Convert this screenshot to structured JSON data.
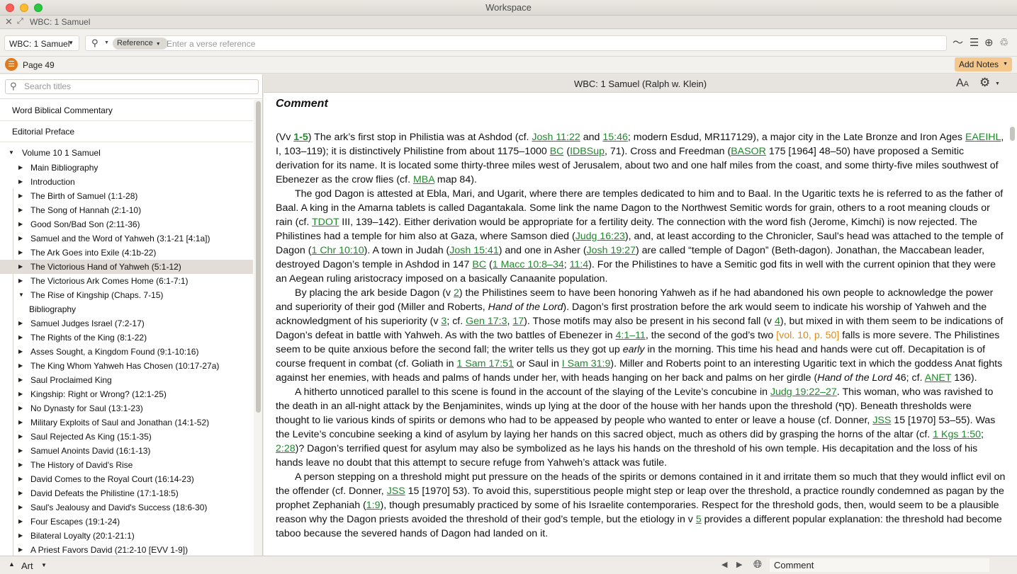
{
  "window": {
    "title": "Workspace"
  },
  "tab": {
    "label": "WBC: 1 Samuel"
  },
  "toolbar": {
    "resource": "WBC: 1 Samuel",
    "search_mode": "Reference",
    "search_placeholder": "Enter a verse reference"
  },
  "pagebar": {
    "page": "Page 49",
    "add_notes": "Add Notes"
  },
  "sidebar": {
    "search_placeholder": "Search titles",
    "top_items": [
      "Word Biblical Commentary",
      "Editorial Preface"
    ],
    "volume": "Volume 10 1 Samuel",
    "items": [
      {
        "label": "Main Bibliography",
        "arrow": "▶"
      },
      {
        "label": "Introduction",
        "arrow": "▶"
      },
      {
        "label": "The Birth of Samuel (1:1-28)",
        "arrow": "▶"
      },
      {
        "label": "The Song of Hannah (2:1-10)",
        "arrow": "▶"
      },
      {
        "label": "Good Son/Bad Son (2:11-36)",
        "arrow": "▶"
      },
      {
        "label": "Samuel and the Word of Yahweh (3:1-21 [4:1a])",
        "arrow": "▶"
      },
      {
        "label": "The Ark Goes into Exile (4:1b-22)",
        "arrow": "▶"
      },
      {
        "label": "The Victorious Hand of Yahweh (5:1-12)",
        "arrow": "▶",
        "selected": true
      },
      {
        "label": "The Victorious Ark Comes Home (6:1-7:1)",
        "arrow": "▶"
      },
      {
        "label": "The Rise of Kingship (Chaps. 7-15)",
        "arrow": "▼"
      },
      {
        "label": "Bibliography",
        "arrow": "",
        "sub": true
      },
      {
        "label": "Samuel Judges Israel (7:2-17)",
        "arrow": "▶"
      },
      {
        "label": "The Rights of the King (8:1-22)",
        "arrow": "▶"
      },
      {
        "label": "Asses Sought, a Kingdom Found (9:1-10:16)",
        "arrow": "▶"
      },
      {
        "label": "The King Whom Yahweh Has Chosen (10:17-27a)",
        "arrow": "▶"
      },
      {
        "label": "Saul Proclaimed King",
        "arrow": "▶"
      },
      {
        "label": "Kingship: Right or Wrong?  (12:1-25)",
        "arrow": "▶"
      },
      {
        "label": "No Dynasty for Saul (13:1-23)",
        "arrow": "▶"
      },
      {
        "label": "Military Exploits of Saul and Jonathan (14:1-52)",
        "arrow": "▶"
      },
      {
        "label": "Saul Rejected As King (15:1-35)",
        "arrow": "▶"
      },
      {
        "label": "Samuel Anoints David (16:1-13)",
        "arrow": "▶"
      },
      {
        "label": "The History of David's Rise",
        "arrow": "▶"
      },
      {
        "label": "David Comes to the Royal Court (16:14-23)",
        "arrow": "▶"
      },
      {
        "label": "David Defeats the Philistine (17:1-18:5)",
        "arrow": "▶"
      },
      {
        "label": "Saul's Jealousy and David's Success (18:6-30)",
        "arrow": "▶"
      },
      {
        "label": "Four Escapes (19:1-24)",
        "arrow": "▶"
      },
      {
        "label": "Bilateral Loyalty (20:1-21:1)",
        "arrow": "▶"
      },
      {
        "label": "A Priest Favors David (21:2-10 [EVV 1-9])",
        "arrow": "▶"
      }
    ]
  },
  "reader": {
    "title": "WBC: 1 Samuel (Ralph w. Klein)",
    "font_button": "AA",
    "section_title": "Comment"
  },
  "content": {
    "paragraphs": [
      [
        {
          "t": "(Vv "
        },
        {
          "t": "1-5",
          "l": true,
          "b": true
        },
        {
          "t": ") The ark’s first stop in Philistia was at Ashdod (cf. "
        },
        {
          "t": "Josh 11:22",
          "l": true
        },
        {
          "t": " and "
        },
        {
          "t": "15:46",
          "l": true
        },
        {
          "t": "; modern Esdud, MR117129), a major city in the Late Bronze and Iron Ages "
        },
        {
          "t": "EAEIHL",
          "l": true
        },
        {
          "t": ", I, 103–119); it is distinctively Philistine from about 1175–1000 "
        },
        {
          "t": "BC",
          "l": true
        },
        {
          "t": " ("
        },
        {
          "t": "IDBSup",
          "l": true
        },
        {
          "t": ", 71). Cross and Freedman ("
        },
        {
          "t": "BASOR",
          "l": true
        },
        {
          "t": " 175 [1964] 48–50) have proposed a Semitic derivation for its name. It is located some thirty-three miles west of Jerusalem, about two and one half miles from the coast, and some thirty-five miles southwest of Ebenezer as the crow flies (cf. "
        },
        {
          "t": "MBA",
          "l": true
        },
        {
          "t": " map 84)."
        }
      ],
      [
        {
          "t": "The god Dagon is attested at Ebla, Mari, and Ugarit, where there are temples dedicated to him and to Baal. In the Ugaritic texts he is referred to as the father of Baal. A king in the Amarna tablets is called Dagantakala. Some link the name Dagon to the Northwest Semitic words for grain, others to a root meaning clouds or rain (cf. "
        },
        {
          "t": "TDOT",
          "l": true
        },
        {
          "t": " III, 139–142). Either derivation would be appropriate for a fertility deity. The connection with the word fish (Jerome, Kimchi) is now rejected. The Philistines had a temple for him also at Gaza, where Samson died ("
        },
        {
          "t": "Judg 16:23",
          "l": true
        },
        {
          "t": "), and, at least according to the Chronicler, Saul’s head was attached to the temple of Dagon ("
        },
        {
          "t": "1 Chr 10:10",
          "l": true
        },
        {
          "t": "). A town in Judah ("
        },
        {
          "t": "Josh 15:41",
          "l": true
        },
        {
          "t": ") and one in Asher ("
        },
        {
          "t": "Josh 19:27",
          "l": true
        },
        {
          "t": ") are called “temple of Dagon” (Beth-dagon). Jonathan, the Maccabean leader, destroyed Dagon’s temple in Ashdod in 147 "
        },
        {
          "t": "BC",
          "l": true
        },
        {
          "t": " ("
        },
        {
          "t": "1 Macc 10:8–34",
          "l": true
        },
        {
          "t": "; "
        },
        {
          "t": "11:4",
          "l": true
        },
        {
          "t": "). For the Philistines to have a Semitic god fits in well with the current opinion that they were an Aegean ruling aristocracy imposed on a basically Canaanite population."
        }
      ],
      [
        {
          "t": "By placing the ark beside Dagon (v "
        },
        {
          "t": "2",
          "l": true
        },
        {
          "t": ") the Philistines seem to have been honoring Yahweh as if he had abandoned his own people to acknowledge the power and superiority of their god (Miller and Roberts, "
        },
        {
          "t": "Hand of the Lord",
          "i": true
        },
        {
          "t": "). Dagon’s first prostration before the ark would seem to indicate his worship of Yahweh and the acknowledgment of his superiority (v "
        },
        {
          "t": "3",
          "l": true
        },
        {
          "t": "; cf. "
        },
        {
          "t": "Gen 17:3",
          "l": true
        },
        {
          "t": ", "
        },
        {
          "t": "17",
          "l": true
        },
        {
          "t": "). Those motifs may also be present in his second fall (v "
        },
        {
          "t": "4",
          "l": true
        },
        {
          "t": "), but mixed in with them seem to be indications of Dagon’s defeat in battle with Yahweh. As with the two battles of Ebenezer in "
        },
        {
          "t": "4:1–11",
          "l": true
        },
        {
          "t": ", the second of the god’s two "
        },
        {
          "t": "[vol. 10, p. 50]",
          "o": true
        },
        {
          "t": " falls is more severe. The Philistines seem to be quite anxious before the second fall; the writer tells us they got up "
        },
        {
          "t": "early",
          "i": true
        },
        {
          "t": " in the morning. This time his head and hands were cut off. Decapitation is of course frequent in combat (cf. Goliath in "
        },
        {
          "t": "1 Sam 17:51",
          "l": true
        },
        {
          "t": " or Saul in "
        },
        {
          "t": "I Sam 31:9",
          "l": true
        },
        {
          "t": "). Miller and Roberts point to an interesting Ugaritic text in which the goddess Anat fights against her enemies, with heads and palms of hands under her, with heads hanging on her back and palms on her girdle ("
        },
        {
          "t": "Hand of the Lord",
          "i": true
        },
        {
          "t": " 46; cf. "
        },
        {
          "t": "ANET",
          "l": true
        },
        {
          "t": " 136)."
        }
      ],
      [
        {
          "t": "A hitherto unnoticed parallel to this scene is found in the account of the slaying of the Levite’s concubine in "
        },
        {
          "t": "Judg 19:22–27",
          "l": true
        },
        {
          "t": ". This woman, who was ravished to the death in an all-night attack by the Benjaminites, winds up lying at the door of the house with her hands upon the threshold (סַף). Beneath thresholds were thought to lie various kinds of spirits or demons who had to be appeased by people who wanted to enter or leave a house (cf. Donner, "
        },
        {
          "t": "JSS",
          "l": true
        },
        {
          "t": " 15 [1970] 53–55). Was the Levite’s concubine seeking a kind of asylum by laying her hands on this sacred object, much as others did by grasping the horns of the altar (cf. "
        },
        {
          "t": "1 Kgs 1:50",
          "l": true
        },
        {
          "t": "; "
        },
        {
          "t": "2:28",
          "l": true
        },
        {
          "t": ")? Dagon’s terrified quest for asylum may also be symbolized as he lays his hands on the threshold of his own temple. His decapitation and the loss of his hands leave no doubt that this attempt to secure refuge from Yahweh’s attack was futile."
        }
      ],
      [
        {
          "t": "A person stepping on a threshold might put pressure on the heads of the spirits or demons contained in it and irritate them so much that they would inflict evil on the offender (cf. Donner, "
        },
        {
          "t": "JSS",
          "l": true
        },
        {
          "t": " 15 [1970] 53). To avoid this, superstitious people might step or leap over the threshold, a practice roundly condemned as pagan by the prophet Zephaniah ("
        },
        {
          "t": "1:9",
          "l": true
        },
        {
          "t": "), though presumably practiced by some of his Israelite contemporaries. Respect for the threshold gods, then, would seem to be a plausible reason why the Dagon priests avoided the threshold of their god’s temple, but the etiology in v "
        },
        {
          "t": "5",
          "l": true
        },
        {
          "t": " provides a different popular explanation: the threshold had become taboo because the severed hands of Dagon had landed on it."
        }
      ]
    ]
  },
  "statusbar": {
    "left_label": "Art",
    "right_field": "Comment"
  }
}
